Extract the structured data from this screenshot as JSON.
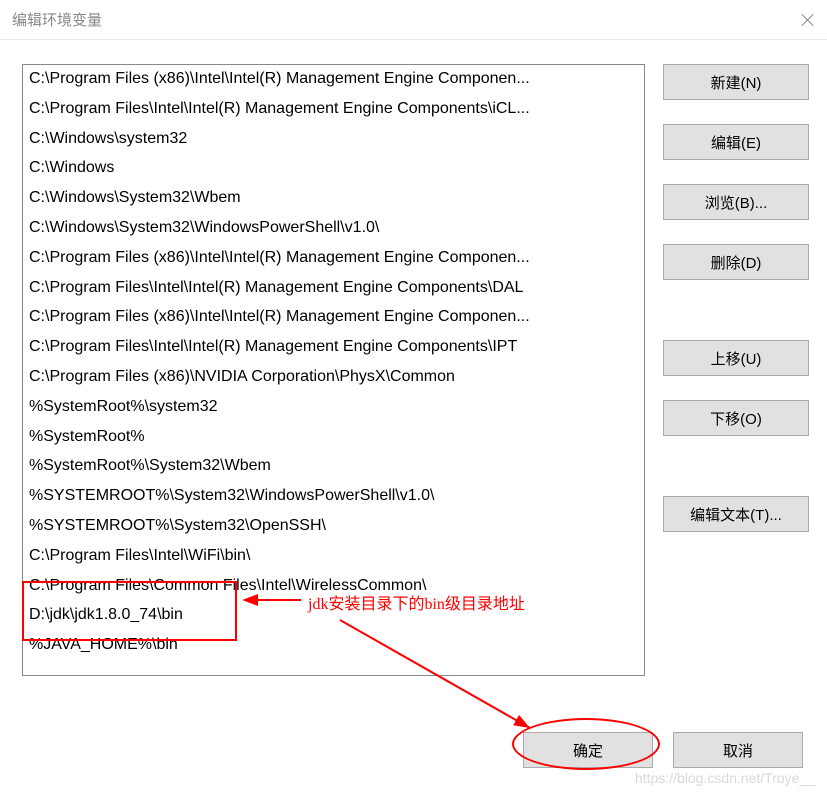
{
  "window": {
    "title": "编辑环境变量"
  },
  "paths": [
    "C:\\Program Files (x86)\\Intel\\Intel(R) Management Engine Componen...",
    "C:\\Program Files\\Intel\\Intel(R) Management Engine Components\\iCL...",
    "C:\\Windows\\system32",
    "C:\\Windows",
    "C:\\Windows\\System32\\Wbem",
    "C:\\Windows\\System32\\WindowsPowerShell\\v1.0\\",
    "C:\\Program Files (x86)\\Intel\\Intel(R) Management Engine Componen...",
    "C:\\Program Files\\Intel\\Intel(R) Management Engine Components\\DAL",
    "C:\\Program Files (x86)\\Intel\\Intel(R) Management Engine Componen...",
    "C:\\Program Files\\Intel\\Intel(R) Management Engine Components\\IPT",
    "C:\\Program Files (x86)\\NVIDIA Corporation\\PhysX\\Common",
    "%SystemRoot%\\system32",
    "%SystemRoot%",
    "%SystemRoot%\\System32\\Wbem",
    "%SYSTEMROOT%\\System32\\WindowsPowerShell\\v1.0\\",
    "%SYSTEMROOT%\\System32\\OpenSSH\\",
    "C:\\Program Files\\Intel\\WiFi\\bin\\",
    "C:\\Program Files\\Common Files\\Intel\\WirelessCommon\\",
    "D:\\jdk\\jdk1.8.0_74\\bin",
    "%JAVA_HOME%\\bin"
  ],
  "buttons": {
    "new": "新建(N)",
    "edit": "编辑(E)",
    "browse": "浏览(B)...",
    "delete": "删除(D)",
    "moveup": "上移(U)",
    "movedown": "下移(O)",
    "edittext": "编辑文本(T)...",
    "ok": "确定",
    "cancel": "取消"
  },
  "annotation": {
    "label": "jdk安装目录下的bin级目录地址"
  },
  "watermark": "https://blog.csdn.net/Troye__"
}
